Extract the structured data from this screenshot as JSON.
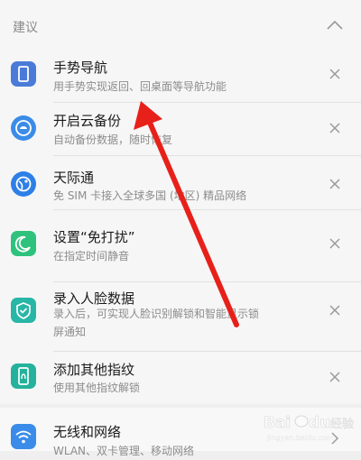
{
  "section": {
    "title": "建议"
  },
  "items": [
    {
      "title": "手势导航",
      "subtitle": "用手势实现返回、回桌面等导航功能",
      "icon": "phone-frame-icon",
      "color": "#4a7bd8"
    },
    {
      "title": "开启云备份",
      "subtitle": "自动备份数据，随时恢复",
      "icon": "cloud-backup-icon",
      "color": "#3b8ce8"
    },
    {
      "title": "天际通",
      "subtitle": "免 SIM 卡接入全球多国 (地区) 精品网络",
      "icon": "globe-icon",
      "color": "#2e7fe6"
    },
    {
      "title": "设置“免打扰”",
      "subtitle": "在指定时间静音",
      "icon": "moon-icon",
      "color": "#2fc27d"
    },
    {
      "title": "录入人脸数据",
      "subtitle_line1": "录入后，可实现人脸识别解锁和智能显示锁",
      "subtitle_line2": "屏通知",
      "icon": "face-shield-icon",
      "color": "#28b6a6"
    },
    {
      "title": "添加其他指纹",
      "subtitle": "使用其他指纹解锁",
      "icon": "fingerprint-phone-icon",
      "color": "#25b29c"
    }
  ],
  "bottom": {
    "title": "无线和网络",
    "subtitle": "WLAN、双卡管理、移动网络",
    "icon": "wifi-icon",
    "color": "#3b8ce8"
  },
  "watermark": {
    "text": "Bai du 经验",
    "sub": "jingyan.baidu.com"
  },
  "annotation": {
    "arrow_color": "#e8201a"
  }
}
